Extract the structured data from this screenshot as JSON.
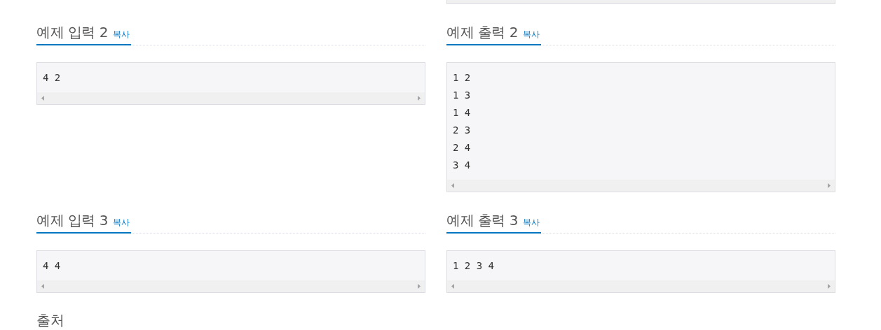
{
  "rows": [
    {
      "input": {
        "title": "예제 입력 2",
        "copy": "복사",
        "lines": [
          "4 2"
        ]
      },
      "output": {
        "title": "예제 출력 2",
        "copy": "복사",
        "lines": [
          "1 2",
          "1 3",
          "1 4",
          "2 3",
          "2 4",
          "3 4"
        ]
      }
    },
    {
      "input": {
        "title": "예제 입력 3",
        "copy": "복사",
        "lines": [
          "4 4"
        ]
      },
      "output": {
        "title": "예제 출력 3",
        "copy": "복사",
        "lines": [
          "1 2 3 4"
        ]
      }
    }
  ],
  "source": {
    "title": "출처"
  }
}
